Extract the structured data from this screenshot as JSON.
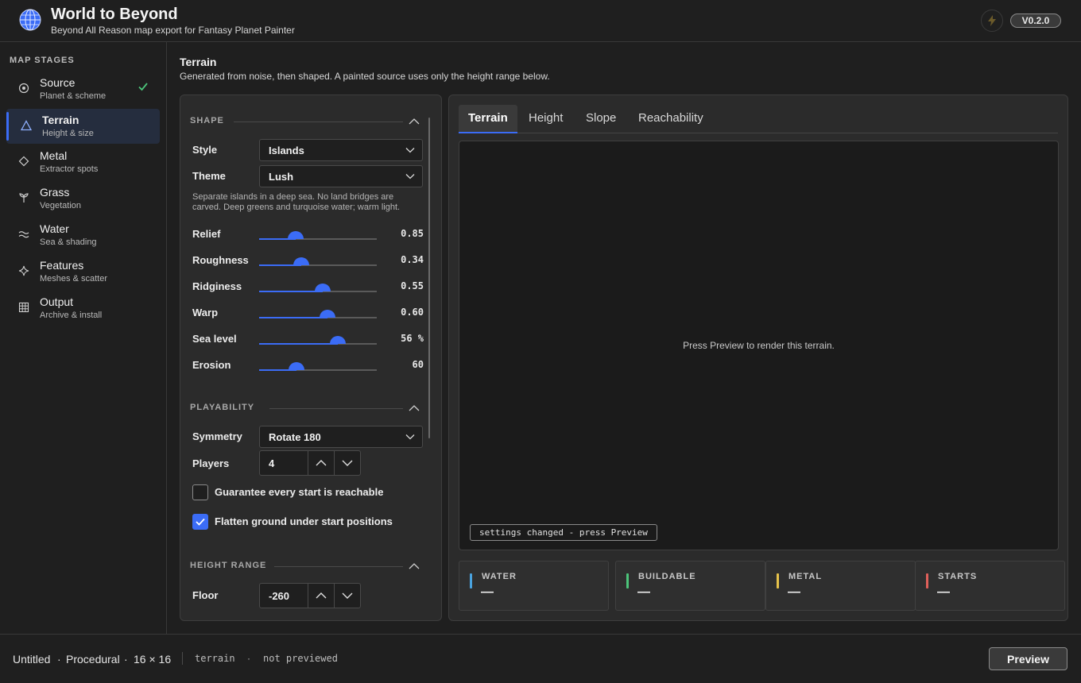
{
  "header": {
    "title": "World to Beyond",
    "subtitle": "Beyond All Reason map export for Fantasy Planet Painter",
    "version": "V0.2.0"
  },
  "sidebar": {
    "title": "MAP STAGES",
    "stages": [
      {
        "name": "Source",
        "sub": "Planet & scheme",
        "icon": "target-icon",
        "done": true
      },
      {
        "name": "Terrain",
        "sub": "Height & size",
        "icon": "triangle-icon",
        "active": true
      },
      {
        "name": "Metal",
        "sub": "Extractor spots",
        "icon": "diamond-icon"
      },
      {
        "name": "Grass",
        "sub": "Vegetation",
        "icon": "sprout-icon"
      },
      {
        "name": "Water",
        "sub": "Sea & shading",
        "icon": "waves-icon"
      },
      {
        "name": "Features",
        "sub": "Meshes & scatter",
        "icon": "sparkle-icon"
      },
      {
        "name": "Output",
        "sub": "Archive & install",
        "icon": "grid-icon"
      }
    ]
  },
  "page": {
    "title": "Terrain",
    "description": "Generated from noise, then shaped. A painted source uses only the height range below."
  },
  "shape": {
    "label": "SHAPE",
    "style_label": "Style",
    "style_value": "Islands",
    "theme_label": "Theme",
    "theme_value": "Lush",
    "hint": "Separate islands in a deep sea. No land bridges are carved. Deep greens and turquoise water; warm light.",
    "sliders": [
      {
        "label": "Relief",
        "display": "0.85",
        "fraction": 0.31
      },
      {
        "label": "Roughness",
        "display": "0.34",
        "fraction": 0.36
      },
      {
        "label": "Ridginess",
        "display": "0.55",
        "fraction": 0.54
      },
      {
        "label": "Warp",
        "display": "0.60",
        "fraction": 0.58
      },
      {
        "label": "Sea level",
        "display": "56 %",
        "fraction": 0.67
      },
      {
        "label": "Erosion",
        "display": "60",
        "fraction": 0.32
      }
    ]
  },
  "playability": {
    "label": "PLAYABILITY",
    "symmetry_label": "Symmetry",
    "symmetry_value": "Rotate 180",
    "players_label": "Players",
    "players_value": "4",
    "reachable_label": "Guarantee every start is reachable",
    "reachable_checked": false,
    "flatten_label": "Flatten ground under start positions",
    "flatten_checked": true
  },
  "height_range": {
    "label": "HEIGHT RANGE",
    "floor_label": "Floor",
    "floor_value": "-260"
  },
  "preview": {
    "tabs": [
      "Terrain",
      "Height",
      "Slope",
      "Reachability"
    ],
    "active_tab": "Terrain",
    "message": "Press Preview to render this terrain.",
    "status": "settings changed - press Preview",
    "stats": [
      {
        "name": "WATER",
        "value": "—",
        "color": "#4aa3df"
      },
      {
        "name": "BUILDABLE",
        "value": "—",
        "color": "#4cc47a"
      },
      {
        "name": "METAL",
        "value": "—",
        "color": "#e6c24a"
      },
      {
        "name": "STARTS",
        "value": "—",
        "color": "#e0605a"
      }
    ]
  },
  "footer": {
    "project": "Untitled",
    "mode": "Procedural",
    "size": "16 × 16",
    "stage": "terrain",
    "state": "not previewed",
    "preview_button": "Preview"
  },
  "colors": {
    "accent": "#3b6cf6",
    "check_green": "#4cc47a"
  }
}
